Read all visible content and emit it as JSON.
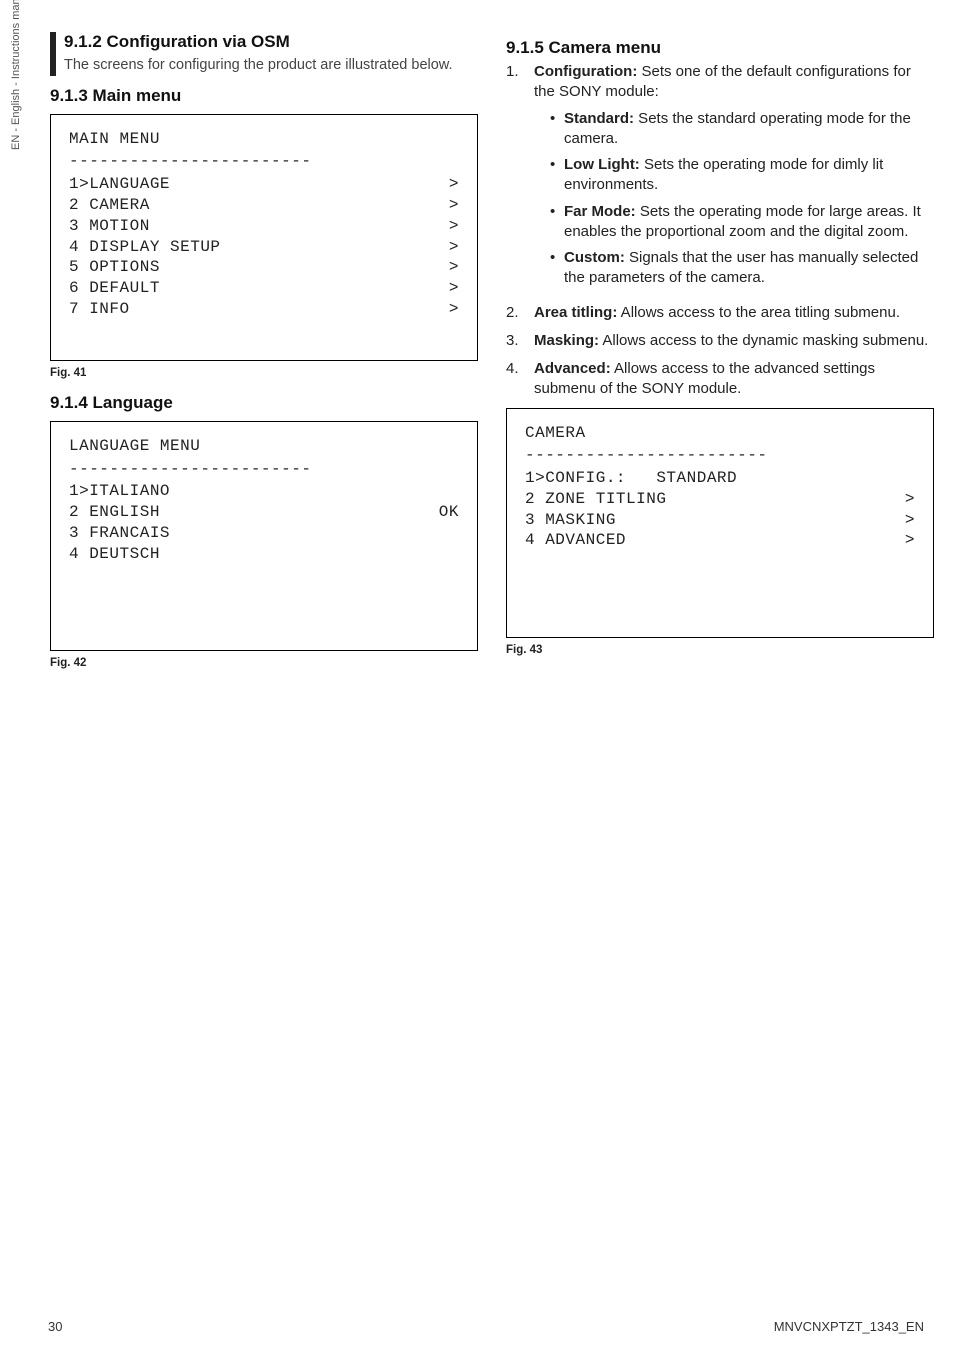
{
  "sidetab": "EN - English - Instructions manual",
  "left": {
    "s912": {
      "title": "9.1.2 Configuration via OSM",
      "intro": "The screens for configuring the product are illustrated below."
    },
    "s913": {
      "title": "9.1.3 Main menu",
      "osd": {
        "title": "MAIN MENU",
        "rule": "------------------------",
        "rows": [
          {
            "l": "1>LANGUAGE",
            "r": ">"
          },
          {
            "l": "2 CAMERA",
            "r": ">"
          },
          {
            "l": "3 MOTION",
            "r": ">"
          },
          {
            "l": "4 DISPLAY SETUP",
            "r": ">"
          },
          {
            "l": "5 OPTIONS",
            "r": ">"
          },
          {
            "l": "6 DEFAULT",
            "r": ">"
          },
          {
            "l": "7 INFO",
            "r": ">"
          }
        ]
      },
      "fig": "Fig. 41"
    },
    "s914": {
      "title": "9.1.4 Language",
      "osd": {
        "title": "LANGUAGE MENU",
        "rule": "------------------------",
        "rows": [
          {
            "l": "1>ITALIANO",
            "r": ""
          },
          {
            "l": "2 ENGLISH",
            "r": "OK"
          },
          {
            "l": "3 FRANCAIS",
            "r": ""
          },
          {
            "l": "4 DEUTSCH",
            "r": ""
          }
        ]
      },
      "fig": "Fig. 42"
    }
  },
  "right": {
    "s915": {
      "title": "9.1.5 Camera menu",
      "items": [
        {
          "num": "1.",
          "lead_b": "Configuration:",
          "lead_t": " Sets one of the default configurations for the SONY module:",
          "bullets": [
            {
              "b": "Standard:",
              "t": " Sets the standard operating mode for the camera."
            },
            {
              "b": "Low Light:",
              "t": " Sets the operating mode for dimly lit environments."
            },
            {
              "b": "Far Mode:",
              "t": " Sets the operating mode for large areas. It enables the proportional zoom and the digital zoom."
            },
            {
              "b": "Custom:",
              "t": " Signals that the user has manually selected the parameters of the camera."
            }
          ]
        },
        {
          "num": "2.",
          "lead_b": "Area titling:",
          "lead_t": " Allows access to the area titling submenu."
        },
        {
          "num": "3.",
          "lead_b": "Masking:",
          "lead_t": " Allows access to the dynamic masking submenu."
        },
        {
          "num": "4.",
          "lead_b": "Advanced:",
          "lead_t": " Allows access to the advanced settings submenu of the SONY module."
        }
      ],
      "osd": {
        "title": "CAMERA",
        "rule": "------------------------",
        "rows": [
          {
            "l": "1>CONFIG.:   STANDARD",
            "r": ""
          },
          {
            "l": "2 ZONE TITLING",
            "r": ">"
          },
          {
            "l": "3 MASKING",
            "r": ">"
          },
          {
            "l": "4 ADVANCED",
            "r": ">"
          }
        ]
      },
      "fig": "Fig. 43"
    }
  },
  "footer": {
    "page": "30",
    "doc": "MNVCNXPTZT_1343_EN"
  }
}
